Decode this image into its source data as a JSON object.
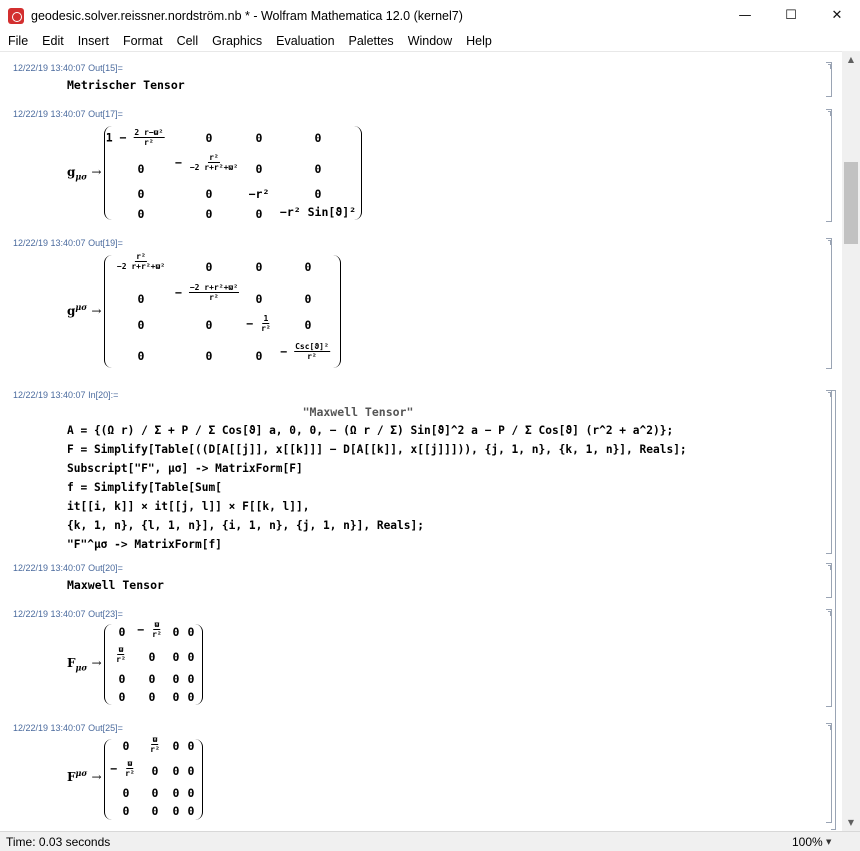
{
  "window": {
    "title": "geodesic.solver.reissner.nordström.nb * - Wolfram Mathematica 12.0 (kernel7)",
    "minimize": "—",
    "maximize": "☐",
    "close": "✕"
  },
  "menu": [
    "File",
    "Edit",
    "Insert",
    "Format",
    "Cell",
    "Graphics",
    "Evaluation",
    "Palettes",
    "Window",
    "Help"
  ],
  "cells": {
    "out15": {
      "label": "12/22/19 13:40:07 Out[15]=",
      "text": "Metrischer Tensor"
    },
    "out17": {
      "label": "12/22/19 13:40:07 Out[17]=",
      "symbol": "g",
      "indices": "μσ",
      "arrow": "→",
      "rows": [
        [
          "1 −",
          "2 r−ϖ²",
          "r²",
          "0",
          "0",
          "0"
        ],
        [
          "0",
          "−",
          "r²",
          "−2 r+r²+ϖ²",
          "0",
          "0"
        ],
        [
          "0",
          "0",
          "−r²",
          "0"
        ],
        [
          "0",
          "0",
          "0",
          "−r² Sin[ϑ]²"
        ]
      ]
    },
    "out19": {
      "label": "12/22/19 13:40:07 Out[19]=",
      "symbol": "g",
      "indices": "μσ",
      "arrow": "→",
      "r0c0_num": "r²",
      "r0c0_den": "−2 r+r²+ϖ²",
      "r1c1_num": "−2 r+r²+ϖ²",
      "r1c1_den": "r²",
      "r2c2_num": "1",
      "r2c2_den": "r²",
      "r3c3_num": "Csc[ϑ]²",
      "r3c3_den": "r²",
      "zero": "0",
      "minus": "−"
    },
    "in20": {
      "label": "12/22/19 13:40:07 In[20]:=",
      "title": "\"Maxwell Tensor\"",
      "lines": [
        "A = {(Ω r) / Σ + P / Σ Cos[ϑ] a, 0, 0, − (Ω r / Σ) Sin[ϑ]^2 a − P / Σ Cos[ϑ] (r^2 + a^2)};",
        "F = Simplify[Table[((D[A[[j]], x[[k]]] − D[A[[k]], x[[j]]])), {j, 1, n}, {k, 1, n}], Reals];",
        "Subscript[\"F\", μσ] -> MatrixForm[F]",
        "f = Simplify[Table[Sum[",
        "it[[i, k]] × it[[j, l]] × F[[k, l]],",
        "{k, 1, n}, {l, 1, n}], {i, 1, n}, {j, 1, n}], Reals];",
        "\"F\"^μσ -> MatrixForm[f]"
      ]
    },
    "out20": {
      "label": "12/22/19 13:40:07 Out[20]=",
      "text": "Maxwell Tensor"
    },
    "out23": {
      "label": "12/22/19 13:40:07 Out[23]=",
      "symbol": "F",
      "indices": "μσ",
      "arrow": "→",
      "frac_num": "ϖ",
      "frac_den": "r²",
      "minus": "−",
      "zero": "0"
    },
    "out25": {
      "label": "12/22/19 13:40:07 Out[25]=",
      "symbol": "F",
      "indices": "μσ",
      "arrow": "→",
      "frac_num": "ϖ",
      "frac_den": "r²",
      "minus": "−",
      "zero": "0"
    }
  },
  "status": {
    "text": "Time: 0.03 seconds",
    "zoom": "100%"
  }
}
